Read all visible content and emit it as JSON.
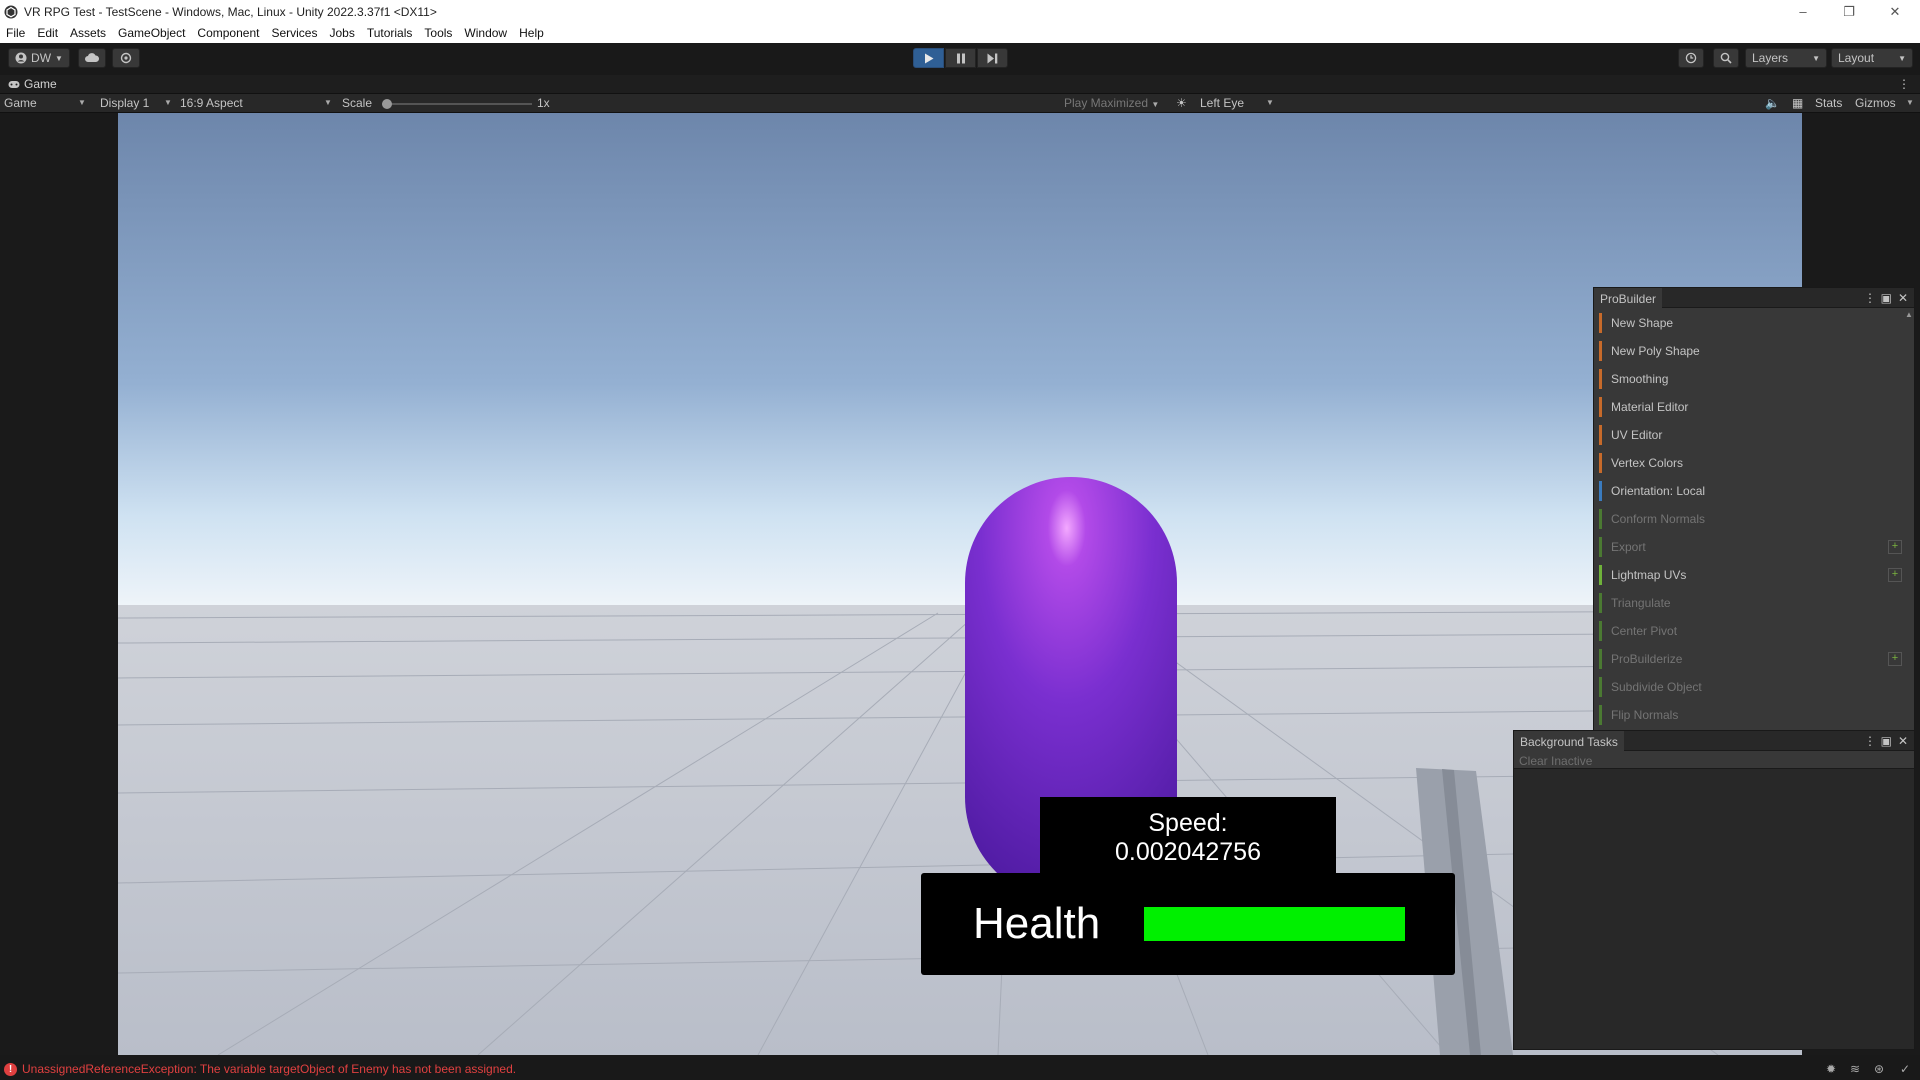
{
  "window": {
    "title": "VR RPG Test - TestScene - Windows, Mac, Linux - Unity 2022.3.37f1 <DX11>",
    "controls": [
      "–",
      "❐",
      "✕"
    ]
  },
  "menu": [
    "File",
    "Edit",
    "Assets",
    "GameObject",
    "Component",
    "Services",
    "Jobs",
    "Tutorials",
    "Tools",
    "Window",
    "Help"
  ],
  "toolbar": {
    "account_label": "DW",
    "layers_label": "Layers",
    "layout_label": "Layout"
  },
  "game_tab": {
    "label": "Game"
  },
  "game_bar": {
    "mode": "Game",
    "display": "Display 1",
    "aspect": "16:9 Aspect",
    "scale_label": "Scale",
    "scale_value": "1x",
    "play_mode": "Play Maximized",
    "eye": "Left Eye",
    "stats": "Stats",
    "gizmos": "Gizmos"
  },
  "hud": {
    "speed_label": "Speed:",
    "speed_value": "0.002042756",
    "health_label": "Health",
    "health_fraction": 1.0,
    "health_color": "#00f000"
  },
  "probuilder": {
    "title": "ProBuilder",
    "items": [
      {
        "label": "New Shape",
        "color": "#c76a2a",
        "enabled": true,
        "plus": false
      },
      {
        "label": "New Poly Shape",
        "color": "#c76a2a",
        "enabled": true,
        "plus": false
      },
      {
        "label": "Smoothing",
        "color": "#c76a2a",
        "enabled": true,
        "plus": false
      },
      {
        "label": "Material Editor",
        "color": "#c76a2a",
        "enabled": true,
        "plus": false
      },
      {
        "label": "UV Editor",
        "color": "#c76a2a",
        "enabled": true,
        "plus": false
      },
      {
        "label": "Vertex Colors",
        "color": "#c76a2a",
        "enabled": true,
        "plus": false
      },
      {
        "label": "Orientation: Local",
        "color": "#3a7bbf",
        "enabled": true,
        "plus": false
      },
      {
        "label": "Conform Normals",
        "color": "#4b7a32",
        "enabled": false,
        "plus": false
      },
      {
        "label": "Export",
        "color": "#4b7a32",
        "enabled": false,
        "plus": true
      },
      {
        "label": "Lightmap UVs",
        "color": "#6fb23a",
        "enabled": true,
        "plus": true
      },
      {
        "label": "Triangulate",
        "color": "#4b7a32",
        "enabled": false,
        "plus": false
      },
      {
        "label": "Center Pivot",
        "color": "#4b7a32",
        "enabled": false,
        "plus": false
      },
      {
        "label": "ProBuilderize",
        "color": "#4b7a32",
        "enabled": false,
        "plus": true
      },
      {
        "label": "Subdivide Object",
        "color": "#4b7a32",
        "enabled": false,
        "plus": false
      },
      {
        "label": "Flip Normals",
        "color": "#4b7a32",
        "enabled": false,
        "plus": false
      }
    ]
  },
  "background_tasks": {
    "title": "Background Tasks",
    "clear_label": "Clear Inactive"
  },
  "status": {
    "error_text": "UnassignedReferenceException: The variable targetObject of Enemy has not been assigned.",
    "error_color": "#e04040"
  }
}
